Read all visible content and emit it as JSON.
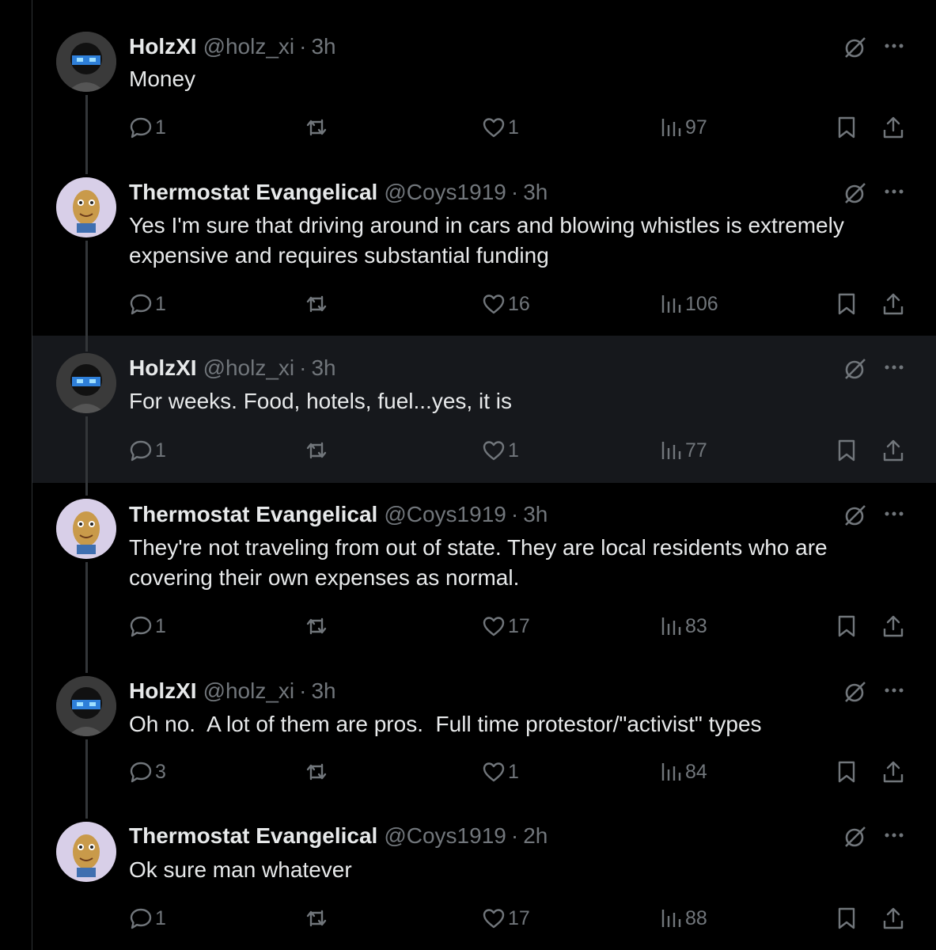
{
  "colors": {
    "background": "#000000",
    "text": "#e7e9ea",
    "muted": "#71767b",
    "highlight": "#16181c"
  },
  "icons": {
    "reply": "reply-icon",
    "retweet": "retweet-icon",
    "like": "heart-icon",
    "views": "views-icon",
    "bookmark": "bookmark-icon",
    "share": "share-icon",
    "grok": "grok-icon",
    "more": "more-icon"
  },
  "separator": "·",
  "tweets": [
    {
      "name": "HolzXI",
      "handle": "@holz_xi",
      "time": "3h",
      "text": "Money",
      "replies": "1",
      "likes": "1",
      "views": "97"
    },
    {
      "name": "Thermostat Evangelical",
      "handle": "@Coys1919",
      "time": "3h",
      "text": "Yes I'm sure that driving around in cars and blowing whistles is extremely expensive and requires substantial funding",
      "replies": "1",
      "likes": "16",
      "views": "106"
    },
    {
      "name": "HolzXI",
      "handle": "@holz_xi",
      "time": "3h",
      "text": "For weeks. Food, hotels, fuel...yes, it is",
      "replies": "1",
      "likes": "1",
      "views": "77"
    },
    {
      "name": "Thermostat Evangelical",
      "handle": "@Coys1919",
      "time": "3h",
      "text": "They're not traveling from out of state. They are local residents who are covering their own expenses as normal.",
      "replies": "1",
      "likes": "17",
      "views": "83"
    },
    {
      "name": "HolzXI",
      "handle": "@holz_xi",
      "time": "3h",
      "text": "Oh no.  A lot of them are pros.  Full time protestor/\"activist\" types",
      "replies": "3",
      "likes": "1",
      "views": "84"
    },
    {
      "name": "Thermostat Evangelical",
      "handle": "@Coys1919",
      "time": "2h",
      "text": "Ok sure man whatever",
      "replies": "1",
      "likes": "17",
      "views": "88"
    }
  ]
}
